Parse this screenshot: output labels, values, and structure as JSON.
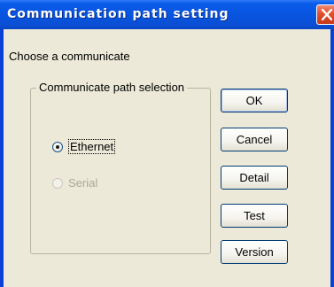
{
  "window": {
    "title": "Communication path setting",
    "close_icon": "close-x-icon"
  },
  "dialog": {
    "caption": "Choose a communicate",
    "group_label": "Communicate path selection",
    "radios": [
      {
        "label": "Ethernet",
        "selected": true,
        "enabled": true
      },
      {
        "label": "Serial",
        "selected": false,
        "enabled": false
      }
    ]
  },
  "buttons": {
    "ok": "OK",
    "cancel": "Cancel",
    "detail": "Detail",
    "test": "Test",
    "version": "Version"
  },
  "colors": {
    "titlebar": "#0855e0",
    "close_button": "#e0502e",
    "dialog_background": "#ece9d8",
    "button_border": "#003c74",
    "disabled_text": "#aca899"
  }
}
